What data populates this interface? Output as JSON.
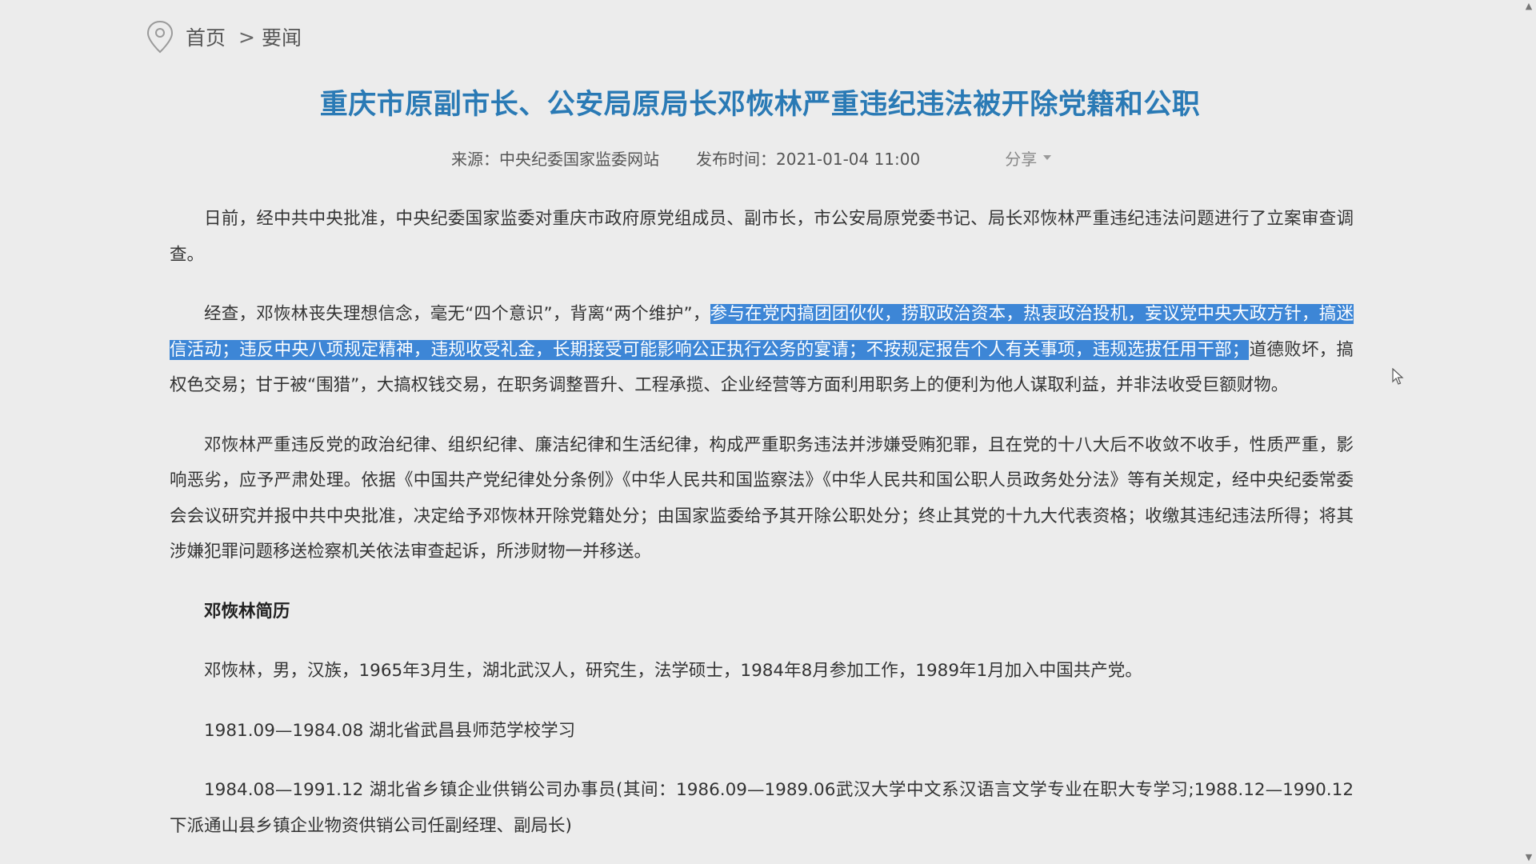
{
  "breadcrumb": {
    "home": "首页",
    "separator": ">",
    "current": "要闻",
    "icon": "location-pin-icon"
  },
  "article": {
    "title": "重庆市原副市长、公安局原局长邓恢林严重违纪违法被开除党籍和公职",
    "source": "来源：中央纪委国家监委网站",
    "published": "发布时间：2021-01-04 11:00",
    "share_label": "分享",
    "p1": "日前，经中共中央批准，中央纪委国家监委对重庆市政府原党组成员、副市长，市公安局原党委书记、局长邓恢林严重违纪违法问题进行了立案审查调查。",
    "p2_before": "经查，邓恢林丧失理想信念，毫无“四个意识”，背离“两个维护”，",
    "p2_highlight": "参与在党内搞团团伙伙，捞取政治资本，热衷政治投机，妄议党中央大政方针，搞迷信活动；违反中央八项规定精神，违规收受礼金，长期接受可能影响公正执行公务的宴请；不按规定报告个人有关事项，违规选拔任用干部；",
    "p2_after": "道德败坏，搞权色交易；甘于被“围猎”，大搞权钱交易，在职务调整晋升、工程承揽、企业经营等方面利用职务上的便利为他人谋取利益，并非法收受巨额财物。",
    "p3": "邓恢林严重违反党的政治纪律、组织纪律、廉洁纪律和生活纪律，构成严重职务违法并涉嫌受贿犯罪，且在党的十八大后不收敛不收手，性质严重，影响恶劣，应予严肃处理。依据《中国共产党纪律处分条例》《中华人民共和国监察法》《中华人民共和国公职人员政务处分法》等有关规定，经中央纪委常委会会议研究并报中共中央批准，决定给予邓恢林开除党籍处分；由国家监委给予其开除公职处分；终止其党的十九大代表资格；收缴其违纪违法所得；将其涉嫌犯罪问题移送检察机关依法审查起诉，所涉财物一并移送。",
    "bio_heading": "邓恢林简历",
    "bio_intro": "邓恢林，男，汉族，1965年3月生，湖北武汉人，研究生，法学硕士，1984年8月参加工作，1989年1月加入中国共产党。",
    "bio_1": "1981.09—1984.08 湖北省武昌县师范学校学习",
    "bio_2": "1984.08—1991.12 湖北省乡镇企业供销公司办事员(其间：1986.09—1989.06武汉大学中文系汉语言文学专业在职大专学习;1988.12—1990.12下派通山县乡镇企业物资供销公司任副经理、副局长)"
  },
  "colors": {
    "title": "#2a7ab5",
    "highlight_bg": "#3d86d6",
    "page_bg": "#ececec"
  }
}
